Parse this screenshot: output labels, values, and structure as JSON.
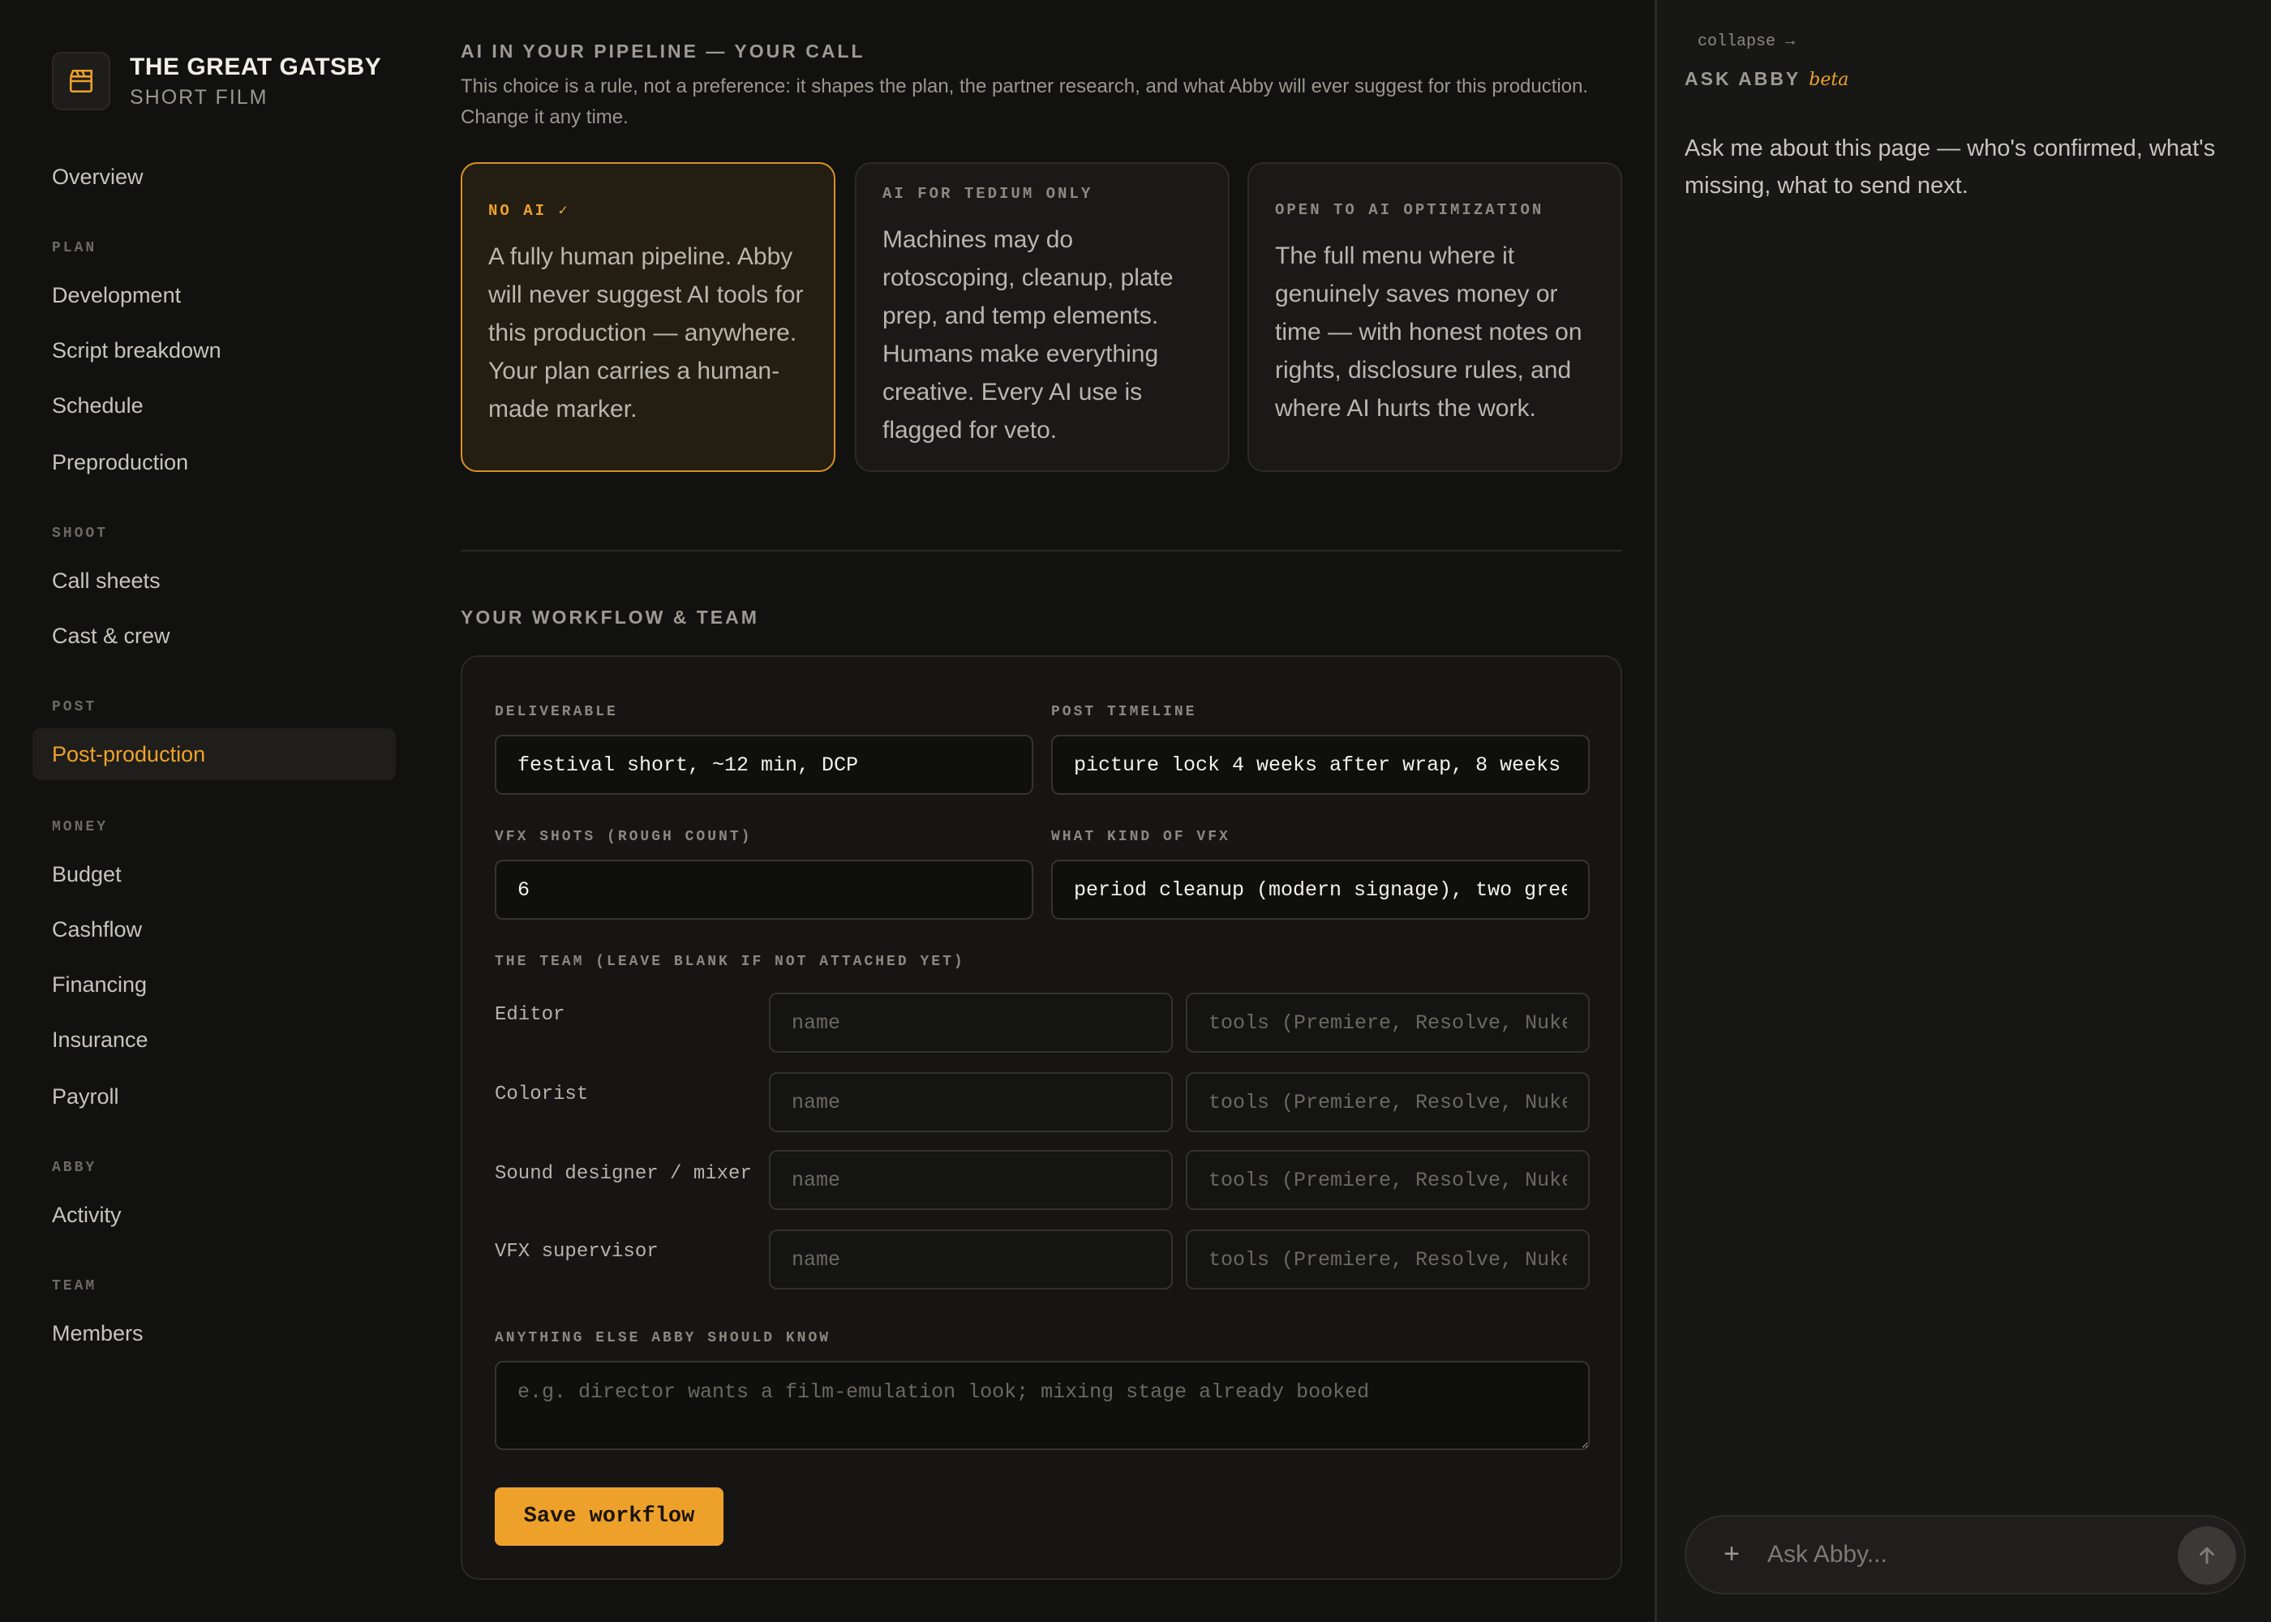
{
  "brand": {
    "title": "THE GREAT GATSBY",
    "subtitle": "SHORT FILM",
    "icon": "clapperboard-icon"
  },
  "sidebar": {
    "overview": "Overview",
    "sections": {
      "plan": "PLAN",
      "shoot": "SHOOT",
      "post": "POST",
      "money": "MONEY",
      "abby": "ABBY",
      "team": "TEAM"
    },
    "items": {
      "development": "Development",
      "script_breakdown": "Script breakdown",
      "schedule": "Schedule",
      "preproduction": "Preproduction",
      "call_sheets": "Call sheets",
      "cast_crew": "Cast & crew",
      "post_production": "Post-production",
      "budget": "Budget",
      "cashflow": "Cashflow",
      "financing": "Financing",
      "insurance": "Insurance",
      "payroll": "Payroll",
      "activity": "Activity",
      "members": "Members"
    },
    "active": "Post-production"
  },
  "ai_policy": {
    "heading": "AI IN YOUR PIPELINE — YOUR CALL",
    "description": "This choice is a rule, not a preference: it shapes the plan, the partner research, and what Abby will ever suggest for this production. Change it any time.",
    "options": [
      {
        "label": "NO AI ✓",
        "text": "A fully human pipeline. Abby will never suggest AI tools for this production — anywhere. Your plan carries a human-made marker.",
        "selected": true
      },
      {
        "label": "AI FOR TEDIUM ONLY",
        "text": "Machines may do rotoscoping, cleanup, plate prep, and temp elements. Humans make everything creative. Every AI use is flagged for veto.",
        "selected": false
      },
      {
        "label": "OPEN TO AI OPTIMIZATION",
        "text": "The full menu where it genuinely saves money or time — with honest notes on rights, disclosure rules, and where AI hurts the work.",
        "selected": false
      }
    ]
  },
  "workflow": {
    "heading": "YOUR WORKFLOW & TEAM",
    "deliverable": {
      "label": "DELIVERABLE",
      "value": "festival short, ~12 min, DCP"
    },
    "post_timeline": {
      "label": "POST TIMELINE",
      "value": "picture lock 4 weeks after wrap, 8 weeks"
    },
    "vfx_shots": {
      "label": "VFX SHOTS (ROUGH COUNT)",
      "value": "6"
    },
    "vfx_kind": {
      "label": "WHAT KIND OF VFX",
      "value": "period cleanup (modern signage), two gree"
    },
    "team_label": "THE TEAM (LEAVE BLANK IF NOT ATTACHED YET)",
    "team": [
      {
        "role": "Editor",
        "name_placeholder": "name",
        "tools_placeholder": "tools (Premiere, Resolve, Nuke"
      },
      {
        "role": "Colorist",
        "name_placeholder": "name",
        "tools_placeholder": "tools (Premiere, Resolve, Nuke"
      },
      {
        "role": "Sound designer / mixer",
        "name_placeholder": "name",
        "tools_placeholder": "tools (Premiere, Resolve, Nuke"
      },
      {
        "role": "VFX supervisor",
        "name_placeholder": "name",
        "tools_placeholder": "tools (Premiere, Resolve, Nuke"
      }
    ],
    "notes": {
      "label": "ANYTHING ELSE ABBY SHOULD KNOW",
      "placeholder": "e.g. director wants a film-emulation look; mixing stage already booked"
    },
    "save_label": "Save workflow"
  },
  "chat": {
    "collapse": "collapse →",
    "title": "ASK ABBY",
    "badge": "beta",
    "intro": "Ask me about this page — who's confirmed, what's missing, what to send next.",
    "placeholder": "Ask Abby...",
    "plus": "+"
  },
  "colors": {
    "accent": "#eea12a",
    "background": "#111110",
    "panel": "#171716"
  }
}
